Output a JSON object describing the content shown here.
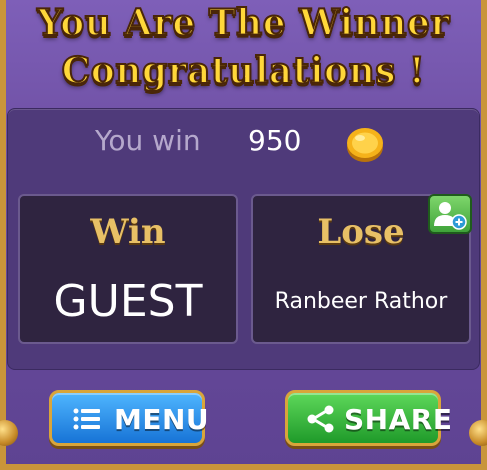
{
  "header": {
    "line1": "You Are The Winner",
    "line2": "Congratulations !"
  },
  "result": {
    "you_win_label": "You win",
    "amount": "950",
    "coin_icon": "gold-coin-icon"
  },
  "win_box": {
    "heading": "Win",
    "player": "GUEST"
  },
  "lose_box": {
    "heading": "Lose",
    "player": "Ranbeer Rathor",
    "add_friend_icon": "add-friend-icon"
  },
  "buttons": {
    "menu_label": "MENU",
    "menu_icon": "list-icon",
    "share_label": "SHARE",
    "share_icon": "share-icon"
  },
  "colors": {
    "title": "#ffd73a",
    "background": "#6b4fa0",
    "menu_button": "#1f86e0",
    "share_button": "#2fb03a",
    "frame_gold": "#c9953a"
  }
}
